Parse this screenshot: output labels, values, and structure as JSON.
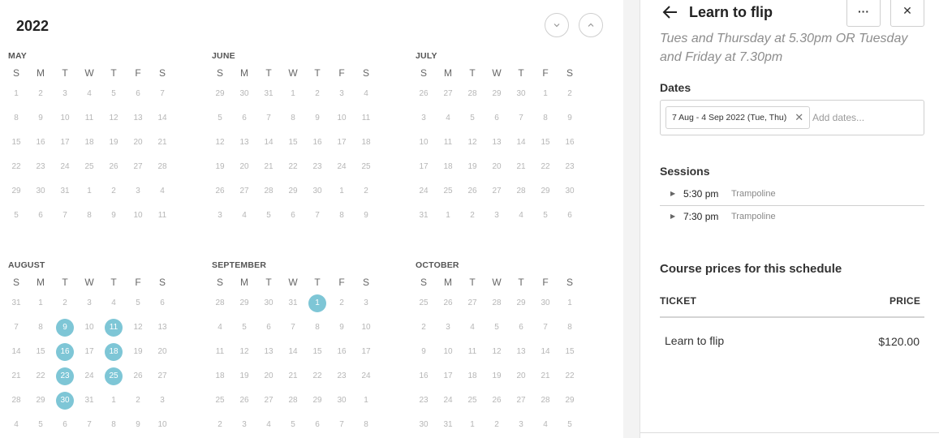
{
  "calendar": {
    "year": "2022",
    "weekdays": [
      "S",
      "M",
      "T",
      "W",
      "T",
      "F",
      "S"
    ],
    "months": [
      {
        "name": "MAY",
        "weeks": [
          [
            "1",
            "2",
            "3",
            "4",
            "5",
            "6",
            "7"
          ],
          [
            "8",
            "9",
            "10",
            "11",
            "12",
            "13",
            "14"
          ],
          [
            "15",
            "16",
            "17",
            "18",
            "19",
            "20",
            "21"
          ],
          [
            "22",
            "23",
            "24",
            "25",
            "26",
            "27",
            "28"
          ],
          [
            "29",
            "30",
            "31",
            "1",
            "2",
            "3",
            "4"
          ],
          [
            "5",
            "6",
            "7",
            "8",
            "9",
            "10",
            "11"
          ]
        ],
        "selected": []
      },
      {
        "name": "JUNE",
        "weeks": [
          [
            "29",
            "30",
            "31",
            "1",
            "2",
            "3",
            "4"
          ],
          [
            "5",
            "6",
            "7",
            "8",
            "9",
            "10",
            "11"
          ],
          [
            "12",
            "13",
            "14",
            "15",
            "16",
            "17",
            "18"
          ],
          [
            "19",
            "20",
            "21",
            "22",
            "23",
            "24",
            "25"
          ],
          [
            "26",
            "27",
            "28",
            "29",
            "30",
            "1",
            "2"
          ],
          [
            "3",
            "4",
            "5",
            "6",
            "7",
            "8",
            "9"
          ]
        ],
        "selected": []
      },
      {
        "name": "JULY",
        "weeks": [
          [
            "26",
            "27",
            "28",
            "29",
            "30",
            "1",
            "2"
          ],
          [
            "3",
            "4",
            "5",
            "6",
            "7",
            "8",
            "9"
          ],
          [
            "10",
            "11",
            "12",
            "13",
            "14",
            "15",
            "16"
          ],
          [
            "17",
            "18",
            "19",
            "20",
            "21",
            "22",
            "23"
          ],
          [
            "24",
            "25",
            "26",
            "27",
            "28",
            "29",
            "30"
          ],
          [
            "31",
            "1",
            "2",
            "3",
            "4",
            "5",
            "6"
          ]
        ],
        "selected": []
      },
      {
        "name": "AUGUST",
        "weeks": [
          [
            "31",
            "1",
            "2",
            "3",
            "4",
            "5",
            "6"
          ],
          [
            "7",
            "8",
            "9",
            "10",
            "11",
            "12",
            "13"
          ],
          [
            "14",
            "15",
            "16",
            "17",
            "18",
            "19",
            "20"
          ],
          [
            "21",
            "22",
            "23",
            "24",
            "25",
            "26",
            "27"
          ],
          [
            "28",
            "29",
            "30",
            "31",
            "1",
            "2",
            "3"
          ],
          [
            "4",
            "5",
            "6",
            "7",
            "8",
            "9",
            "10"
          ]
        ],
        "selected": [
          "9",
          "11",
          "16",
          "18",
          "23",
          "25",
          "30"
        ]
      },
      {
        "name": "SEPTEMBER",
        "weeks": [
          [
            "28",
            "29",
            "30",
            "31",
            "1",
            "2",
            "3"
          ],
          [
            "4",
            "5",
            "6",
            "7",
            "8",
            "9",
            "10"
          ],
          [
            "11",
            "12",
            "13",
            "14",
            "15",
            "16",
            "17"
          ],
          [
            "18",
            "19",
            "20",
            "21",
            "22",
            "23",
            "24"
          ],
          [
            "25",
            "26",
            "27",
            "28",
            "29",
            "30",
            "1"
          ],
          [
            "2",
            "3",
            "4",
            "5",
            "6",
            "7",
            "8"
          ]
        ],
        "selected": [
          "1"
        ]
      },
      {
        "name": "OCTOBER",
        "weeks": [
          [
            "25",
            "26",
            "27",
            "28",
            "29",
            "30",
            "1"
          ],
          [
            "2",
            "3",
            "4",
            "5",
            "6",
            "7",
            "8"
          ],
          [
            "9",
            "10",
            "11",
            "12",
            "13",
            "14",
            "15"
          ],
          [
            "16",
            "17",
            "18",
            "19",
            "20",
            "21",
            "22"
          ],
          [
            "23",
            "24",
            "25",
            "26",
            "27",
            "28",
            "29"
          ],
          [
            "30",
            "31",
            "1",
            "2",
            "3",
            "4",
            "5"
          ]
        ],
        "selected": []
      }
    ],
    "accent_color": "#7ec6d6"
  },
  "detail": {
    "title": "Learn to flip",
    "more_label": "···",
    "close_label": "✕",
    "subtitle": "Tues and Thursday at 5.30pm OR Tuesday and Friday at 7.30pm",
    "dates_label": "Dates",
    "date_chip": "7 Aug - 4 Sep 2022 (Tue, Thu)",
    "dates_placeholder": "Add dates...",
    "sessions_label": "Sessions",
    "sessions": [
      {
        "time": "5:30 pm",
        "room": "Trampoline"
      },
      {
        "time": "7:30 pm",
        "room": "Trampoline"
      }
    ],
    "prices_heading": "Course prices for this schedule",
    "col_ticket": "TICKET",
    "col_price": "PRICE",
    "tickets": [
      {
        "name": "Learn to flip",
        "price": "$120.00"
      }
    ]
  }
}
